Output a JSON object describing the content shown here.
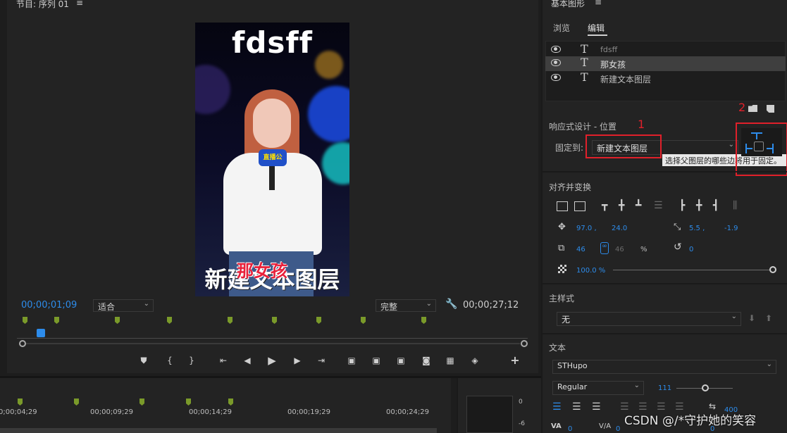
{
  "monitor": {
    "title": "节目: 序列 01",
    "menu_icon": "hamburger-icon",
    "video": {
      "top_text": "fdsff",
      "overlay_text": "那女孩",
      "bottom_text": "新建文本图层",
      "mic_text": "直播公"
    },
    "timecode_current": "00;00;01;09",
    "fit_select": "适合",
    "quality_select": "完整",
    "timecode_duration": "00;00;27;12",
    "transport": [
      "marker-icon",
      "in-point-icon",
      "out-point-icon",
      "go-to-in-icon",
      "step-back-icon",
      "play-icon",
      "step-forward-icon",
      "go-to-out-icon",
      "insert-icon",
      "overwrite-icon",
      "lift-icon",
      "camera-icon",
      "compare-icon",
      "trim-icon"
    ],
    "add_label": "+"
  },
  "timeline": {
    "ruler": [
      "0;00;04;29",
      "00;00;09;29",
      "00;00;14;29",
      "00;00;19;29",
      "00;00;24;29"
    ],
    "meter_labels": [
      "0",
      "-6"
    ]
  },
  "panel": {
    "title": "基本图形",
    "tabs": [
      {
        "label": "浏览",
        "active": false
      },
      {
        "label": "编辑",
        "active": true
      }
    ],
    "layers": [
      {
        "name": "fdsff",
        "selected": false
      },
      {
        "name": "那女孩",
        "selected": true
      },
      {
        "name": "新建文本图层",
        "selected": false
      }
    ],
    "annot_2": "2",
    "responsive": {
      "heading": "响应式设计 - 位置",
      "pin_label": "固定到:",
      "pin_value": "新建文本图层",
      "annot_1": "1",
      "tooltip": "选择父图层的哪些边将用于固定。"
    },
    "align": {
      "heading": "对齐并变换",
      "pos_x": "97.0 ,",
      "pos_y": "24.0",
      "anchor_x": "5.5 ,",
      "anchor_y": "-1.9",
      "scale": "46",
      "scale2": "46",
      "pct": "%",
      "rotation": "0",
      "opacity": "100.0 %"
    },
    "master": {
      "heading": "主样式",
      "value": "无"
    },
    "text": {
      "heading": "文本",
      "font": "STHupo",
      "style": "Regular",
      "size": "111",
      "tracking": "400",
      "va_label": "VA",
      "va_value": "0",
      "va2_label": "V/A",
      "va2_value": "0",
      "aa_value": "0"
    }
  },
  "watermark": "CSDN @/*守护她的笑容"
}
